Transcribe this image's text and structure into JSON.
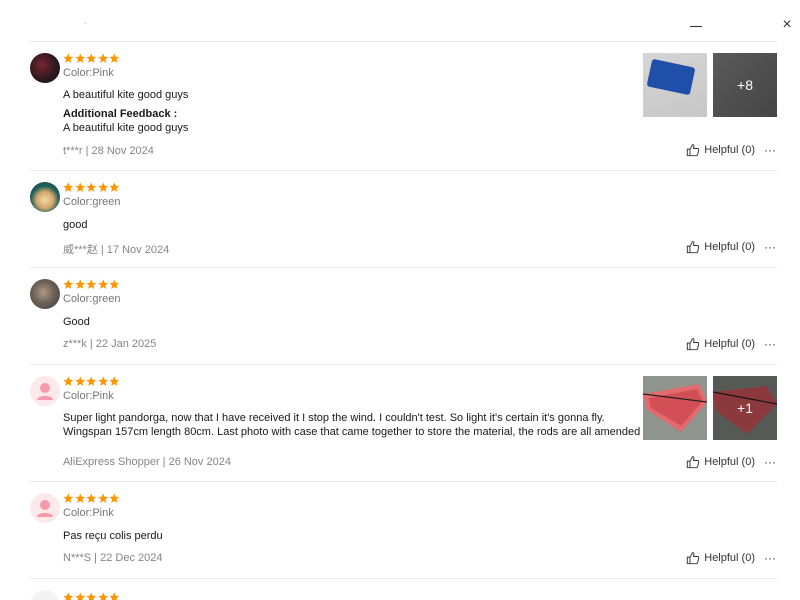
{
  "header": {
    "close_icon": "×"
  },
  "reviews": [
    {
      "rating": 5,
      "color": "Color:Pink",
      "text": "A beautiful kite good guys",
      "additional_label": "Additional Feedback :",
      "additional_text": "A beautiful kite good guys",
      "meta": "t***r | 28 Nov 2024",
      "helpful": "Helpful (0)",
      "photos_more": "+8"
    },
    {
      "rating": 5,
      "color": "Color:green",
      "text": "good",
      "meta": "威***赵 | 17 Nov 2024",
      "helpful": "Helpful (0)"
    },
    {
      "rating": 5,
      "color": "Color:green",
      "text": "Good",
      "meta": "z***k | 22 Jan 2025",
      "helpful": "Helpful (0)"
    },
    {
      "rating": 5,
      "color": "Color:Pink",
      "text_line1": "Super light pandorga, now that I have received it I stop the wind. I couldn't test. So light it's certain it's gonna fly.",
      "text_line2": "Wingspan 157cm length 80cm. Last photo with case that came together to store the material, the rods are all amended",
      "meta": "AliExpress Shopper | 26 Nov 2024",
      "helpful": "Helpful (0)",
      "photos_more": "+1"
    },
    {
      "rating": 5,
      "color": "Color:Pink",
      "text": "Pas reçu colis perdu",
      "meta": "N***S | 22 Dec 2024",
      "helpful": "Helpful (0)"
    }
  ],
  "more_icon": "···",
  "colors": {
    "star": "#ff9500",
    "muted": "#757575",
    "divider": "#e8e8e8"
  }
}
